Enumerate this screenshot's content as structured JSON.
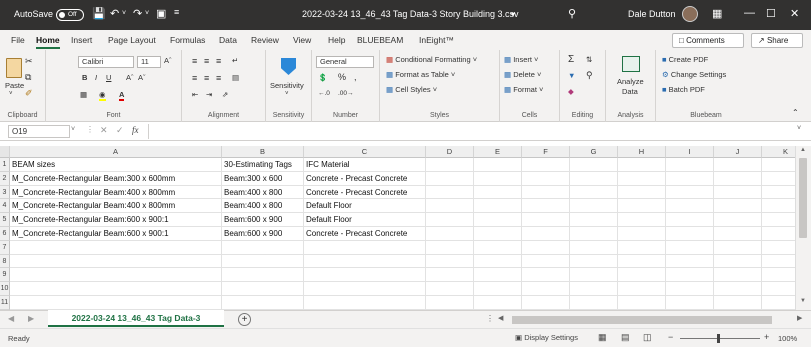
{
  "titlebar": {
    "autosave_label": "AutoSave",
    "autosave_state": "Off",
    "doc_title": "2022-03-24 13_46_43 Tag Data-3 Story Building 3.csv",
    "user_name": "Dale Dutton"
  },
  "menu": {
    "tabs": [
      "File",
      "Home",
      "Insert",
      "Page Layout",
      "Formulas",
      "Data",
      "Review",
      "View",
      "Help",
      "BLUEBEAM",
      "InEight™"
    ],
    "comments_label": "Comments",
    "share_label": "Share"
  },
  "ribbon": {
    "clipboard": {
      "paste": "Paste",
      "label": "Clipboard"
    },
    "font": {
      "name": "Calibri",
      "size": "11",
      "label": "Font"
    },
    "alignment": {
      "label": "Alignment"
    },
    "sensitivity": {
      "button": "Sensitivity",
      "label": "Sensitivity"
    },
    "number": {
      "format": "General",
      "label": "Number"
    },
    "styles": {
      "conditional": "Conditional Formatting",
      "format_table": "Format as Table",
      "cell_styles": "Cell Styles",
      "label": "Styles"
    },
    "cells": {
      "insert": "Insert",
      "delete": "Delete",
      "format": "Format",
      "label": "Cells"
    },
    "editing": {
      "label": "Editing"
    },
    "analysis": {
      "analyze_line1": "Analyze",
      "analyze_line2": "Data",
      "label": "Analysis"
    },
    "bluebeam": {
      "create_pdf": "Create PDF",
      "change_settings": "Change Settings",
      "batch_pdf": "Batch PDF",
      "label": "Bluebeam"
    }
  },
  "formula_bar": {
    "name_box": "O19",
    "fx": "fx",
    "value": ""
  },
  "columns": [
    "A",
    "B",
    "C",
    "D",
    "E",
    "F",
    "G",
    "H",
    "I",
    "J",
    "K"
  ],
  "rows": [
    [
      "BEAM sizes",
      "30-Estimating Tags",
      "IFC Material"
    ],
    [
      "M_Concrete-Rectangular Beam:300 x 600mm",
      "Beam:300 x 600",
      "Concrete - Precast Concrete"
    ],
    [
      "M_Concrete-Rectangular Beam:400 x 800mm",
      "Beam:400 x 800",
      "Concrete - Precast Concrete"
    ],
    [
      "M_Concrete-Rectangular Beam:400 x 800mm",
      "Beam:400 x 800",
      "Default Floor"
    ],
    [
      "M_Concrete-Rectangular Beam:600 x 900:1",
      "Beam:600 x 900",
      "Default Floor"
    ],
    [
      "M_Concrete-Rectangular Beam:600 x 900:1",
      "Beam:600 x 900",
      "Concrete - Precast Concrete"
    ],
    [
      "",
      "",
      ""
    ],
    [
      "",
      "",
      ""
    ],
    [
      "",
      "",
      ""
    ],
    [
      "",
      "",
      ""
    ],
    [
      "",
      "",
      ""
    ]
  ],
  "row_numbers": [
    "1",
    "2",
    "3",
    "4",
    "5",
    "6",
    "7",
    "8",
    "9",
    "10",
    "11"
  ],
  "sheet_tab": "2022-03-24 13_46_43 Tag Data-3",
  "add_sheet": "+",
  "status": {
    "ready": "Ready",
    "display_settings": "Display Settings",
    "zoom": "100%"
  },
  "colors": {
    "accent": "#1f7244",
    "titlebar": "#323130",
    "ribbon": "#f3f2f1"
  }
}
